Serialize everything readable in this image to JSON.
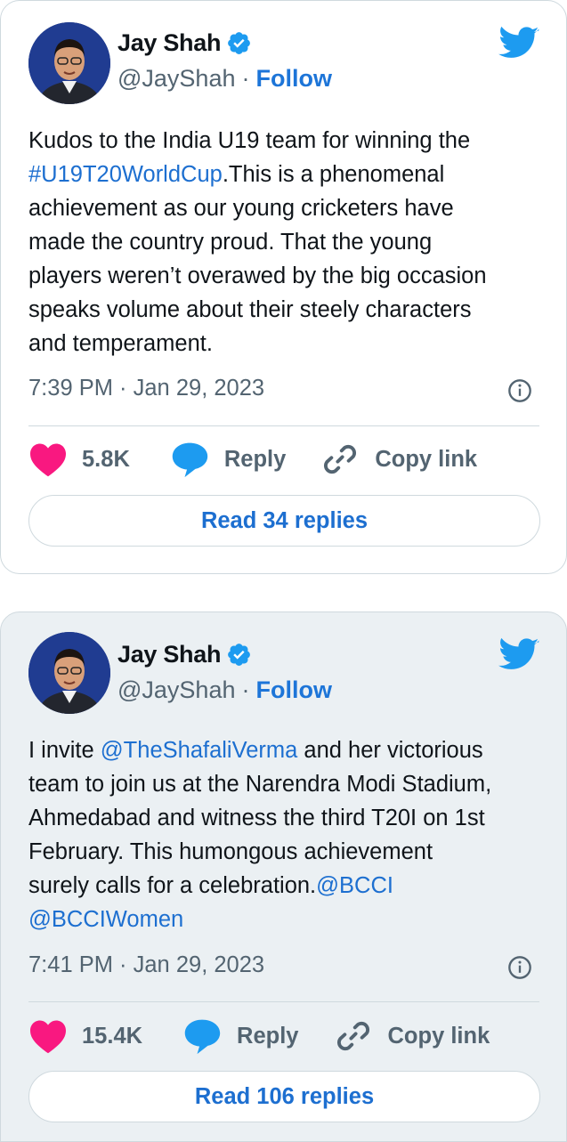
{
  "tweets": [
    {
      "author_name": "Jay Shah",
      "handle": "@JayShah",
      "separator": "·",
      "follow_label": "Follow",
      "text_parts": [
        {
          "t": "Kudos to the India U19 team for winning the\n"
        },
        {
          "t": "#U19T20WorldCup",
          "link": true
        },
        {
          "t": ".This is a phenomenal\nachievement as our young cricketers have\nmade the country proud. That the young\nplayers weren’t overawed by the big occasion\nspeaks volume about their steely characters\nand temperament."
        }
      ],
      "timestamp": "7:39 PM · Jan 29, 2023",
      "likes": "5.8K",
      "reply_label": "Reply",
      "copy_link_label": "Copy link",
      "read_replies_label": "Read 34 replies"
    },
    {
      "author_name": "Jay Shah",
      "handle": "@JayShah",
      "separator": "·",
      "follow_label": "Follow",
      "text_parts": [
        {
          "t": "I invite "
        },
        {
          "t": "@TheShafaliVerma",
          "link": true
        },
        {
          "t": " and her victorious\nteam to join us at the Narendra Modi Stadium,\nAhmedabad and witness the third T20I on 1st\nFebruary. This humongous achievement\nsurely calls for a celebration."
        },
        {
          "t": "@BCCI",
          "link": true
        },
        {
          "t": "\n"
        },
        {
          "t": "@BCCIWomen",
          "link": true
        }
      ],
      "timestamp": "7:41 PM · Jan 29, 2023",
      "likes": "15.4K",
      "reply_label": "Reply",
      "copy_link_label": "Copy link",
      "read_replies_label": "Read 106 replies"
    }
  ],
  "colors": {
    "link": "#1d6fd0",
    "follow": "#1d75d8",
    "twitter_blue": "#1d9bf0",
    "heart": "#f91880",
    "muted": "#536471"
  },
  "icons": [
    "verified-badge-icon",
    "twitter-bird-icon",
    "info-icon",
    "heart-icon",
    "reply-bubble-icon",
    "copy-link-icon"
  ]
}
